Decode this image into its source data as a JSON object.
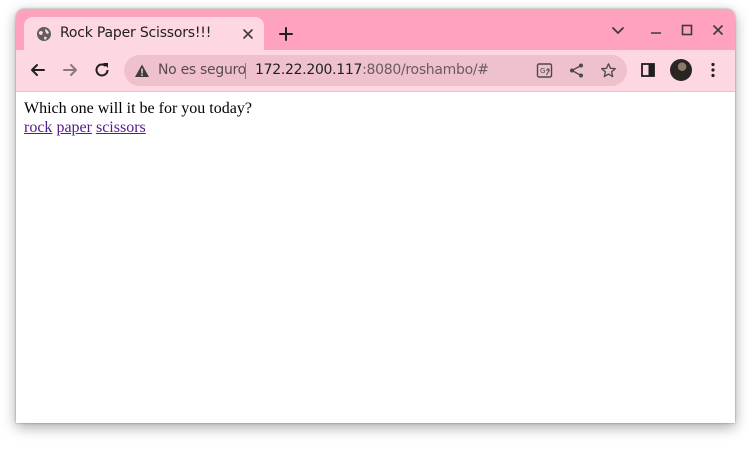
{
  "browser": {
    "tab": {
      "title": "Rock Paper Scissors!!!"
    },
    "address_bar": {
      "security_label": "No es seguro",
      "url_host": "172.22.200.117",
      "url_rest": ":8080/roshambo/#"
    },
    "theme": {
      "frame_color": "#ffa2bd",
      "toolbar_color": "#fdd8e2",
      "omnibox_color": "#efc1cd"
    }
  },
  "page": {
    "prompt": "Which one will it be for you today?",
    "links": [
      {
        "label": "rock"
      },
      {
        "label": "paper"
      },
      {
        "label": "scissors"
      }
    ],
    "link_color": "#551a8b"
  }
}
